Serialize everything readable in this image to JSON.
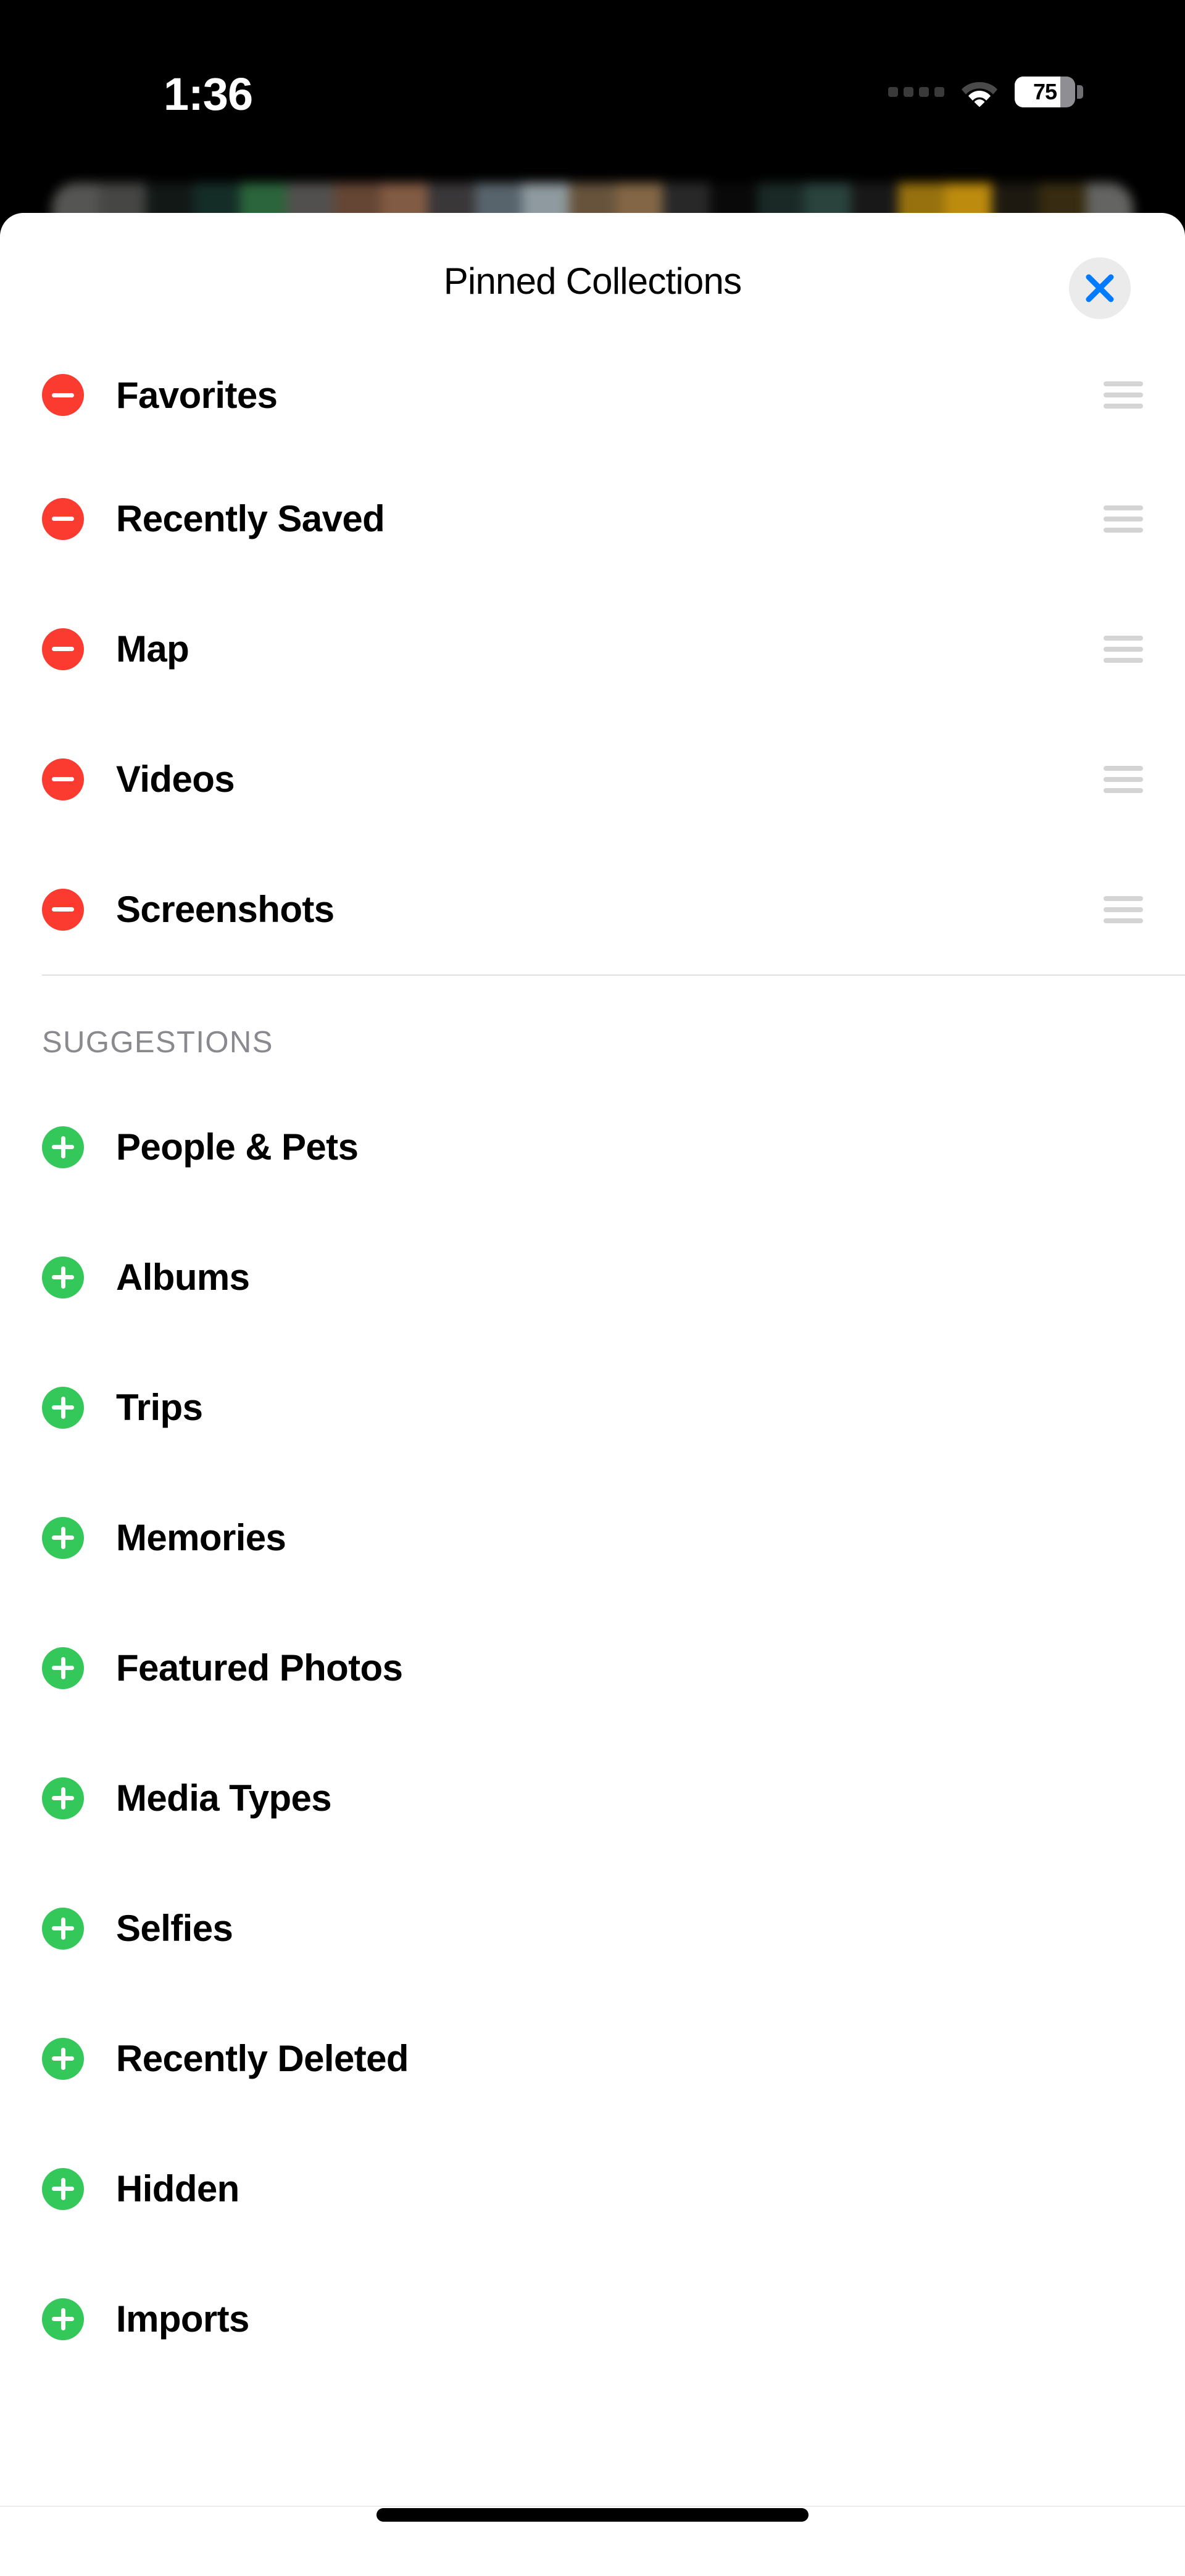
{
  "status_bar": {
    "time": "1:36",
    "cellular_icon": "cellular-signal-icon",
    "cellular_bars": 4,
    "wifi_icon": "wifi-icon",
    "battery_icon": "battery-icon",
    "battery_percent": "75",
    "battery_level": 75
  },
  "sheet": {
    "title": "Pinned Collections",
    "close_icon": "close-icon",
    "close_label": "Close"
  },
  "pinned": {
    "items": [
      {
        "label": "Favorites",
        "action": "remove",
        "action_icon": "minus-circle-icon",
        "handle_icon": "drag-handle-icon"
      },
      {
        "label": "Recently Saved",
        "action": "remove",
        "action_icon": "minus-circle-icon",
        "handle_icon": "drag-handle-icon"
      },
      {
        "label": "Map",
        "action": "remove",
        "action_icon": "minus-circle-icon",
        "handle_icon": "drag-handle-icon"
      },
      {
        "label": "Videos",
        "action": "remove",
        "action_icon": "minus-circle-icon",
        "handle_icon": "drag-handle-icon"
      },
      {
        "label": "Screenshots",
        "action": "remove",
        "action_icon": "minus-circle-icon",
        "handle_icon": "drag-handle-icon"
      }
    ]
  },
  "suggestions": {
    "header": "SUGGESTIONS",
    "items": [
      {
        "label": "People & Pets",
        "action": "add",
        "action_icon": "plus-circle-icon"
      },
      {
        "label": "Albums",
        "action": "add",
        "action_icon": "plus-circle-icon"
      },
      {
        "label": "Trips",
        "action": "add",
        "action_icon": "plus-circle-icon"
      },
      {
        "label": "Memories",
        "action": "add",
        "action_icon": "plus-circle-icon"
      },
      {
        "label": "Featured Photos",
        "action": "add",
        "action_icon": "plus-circle-icon"
      },
      {
        "label": "Media Types",
        "action": "add",
        "action_icon": "plus-circle-icon"
      },
      {
        "label": "Selfies",
        "action": "add",
        "action_icon": "plus-circle-icon"
      },
      {
        "label": "Recently Deleted",
        "action": "add",
        "action_icon": "plus-circle-icon"
      },
      {
        "label": "Hidden",
        "action": "add",
        "action_icon": "plus-circle-icon"
      },
      {
        "label": "Imports",
        "action": "add",
        "action_icon": "plus-circle-icon"
      }
    ]
  },
  "home_indicator": {
    "icon": "home-indicator"
  },
  "colors": {
    "accent_blue": "#007AFF",
    "remove_red": "#FB3B30",
    "add_green": "#34C759",
    "sheet_background": "#FFFFFF",
    "screen_background": "#000000",
    "section_header_gray": "#8A8A8E",
    "handle_gray": "#D4D4D4",
    "close_button_background": "#EBEBEB"
  },
  "background_photo_strip": {
    "description": "blurred photo grid row",
    "swatches": [
      "#5a5a58",
      "#4a4a48",
      "#131a18",
      "#17302a",
      "#2e6b3f",
      "#575553",
      "#6b4a38",
      "#8a6048",
      "#3d3a3c",
      "#5d6a72",
      "#96a3a8",
      "#6d5840",
      "#8a6c4a",
      "#2b2b2b",
      "#0a0a0a",
      "#1c2c28",
      "#2d4741",
      "#1a1a1a",
      "#a0780f",
      "#c8940f",
      "#1f1b12",
      "#3a2f12",
      "#6a6a68"
    ]
  }
}
